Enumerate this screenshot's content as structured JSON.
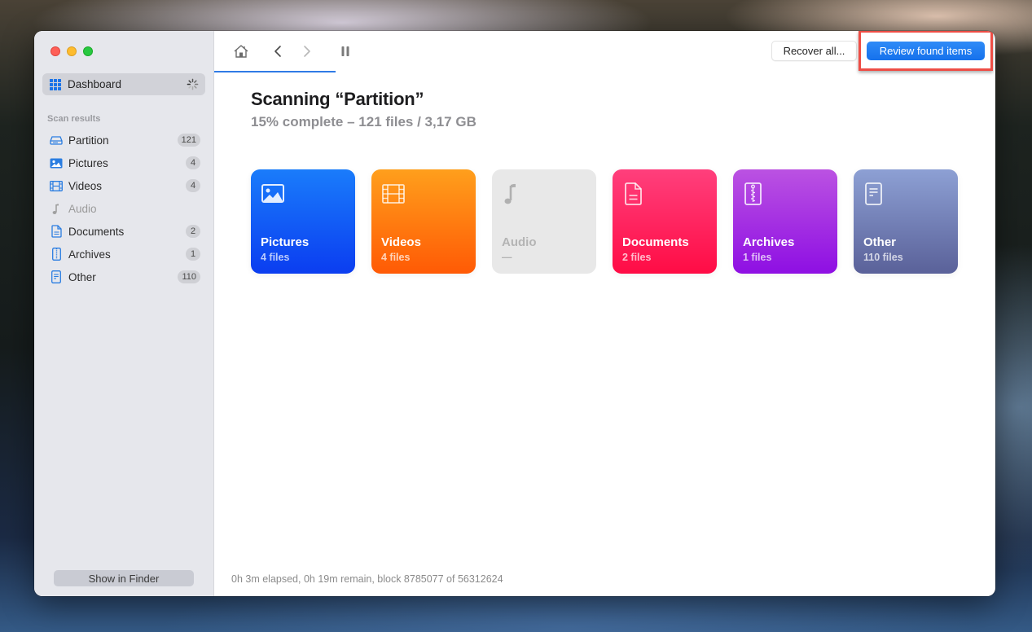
{
  "window": {
    "traffic_lights": [
      "close",
      "minimize",
      "zoom"
    ]
  },
  "sidebar": {
    "dashboard": {
      "label": "Dashboard",
      "icon": "grid-icon",
      "status": "loading-spinner"
    },
    "section_label": "Scan results",
    "items": [
      {
        "label": "Partition",
        "icon": "drive-icon",
        "count": "121",
        "enabled": true
      },
      {
        "label": "Pictures",
        "icon": "photo-icon",
        "count": "4",
        "enabled": true
      },
      {
        "label": "Videos",
        "icon": "film-icon",
        "count": "4",
        "enabled": true
      },
      {
        "label": "Audio",
        "icon": "music-note-icon",
        "count": null,
        "enabled": false
      },
      {
        "label": "Documents",
        "icon": "document-icon",
        "count": "2",
        "enabled": true
      },
      {
        "label": "Archives",
        "icon": "archive-zip-icon",
        "count": "1",
        "enabled": true
      },
      {
        "label": "Other",
        "icon": "other-file-icon",
        "count": "110",
        "enabled": true
      }
    ],
    "show_in_finder_label": "Show in Finder"
  },
  "toolbar": {
    "home_icon": "home-icon",
    "back_icon": "chevron-left-icon",
    "forward_icon": "chevron-right-icon",
    "pause_icon": "pause-icon",
    "recover_all_label": "Recover all...",
    "review_found_label": "Review found items"
  },
  "scan": {
    "title": "Scanning “Partition”",
    "subtitle": "15% complete – 121 files / 3,17 GB",
    "progress_percent": 15,
    "status_line": "0h 3m elapsed, 0h 19m remain, block 8785077 of 56312624"
  },
  "cards": [
    {
      "name": "Pictures",
      "count": "4 files",
      "icon": "photo-icon",
      "color": "#1a5cf8"
    },
    {
      "name": "Videos",
      "count": "4 files",
      "icon": "film-icon",
      "color": "#ff7a10"
    },
    {
      "name": "Audio",
      "count": "—",
      "icon": "music-note-icon",
      "color": "#e8e8e8"
    },
    {
      "name": "Documents",
      "count": "2 files",
      "icon": "document-icon",
      "color": "#ff2560"
    },
    {
      "name": "Archives",
      "count": "1 files",
      "icon": "archive-zip-icon",
      "color": "#a532e3"
    },
    {
      "name": "Other",
      "count": "110 files",
      "icon": "other-file-icon",
      "color": "#7381b8"
    }
  ],
  "colors": {
    "accent": "#1a73e8",
    "highlight_border": "#ee4d45"
  }
}
